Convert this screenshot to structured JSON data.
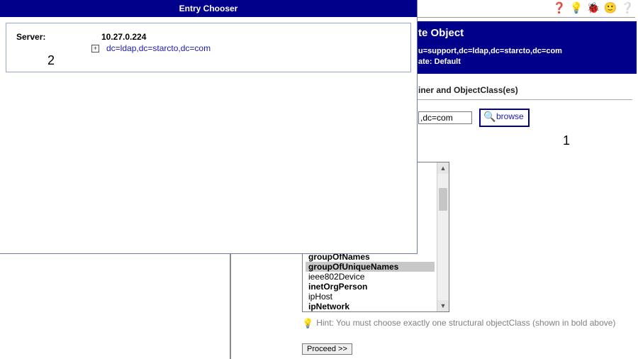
{
  "popup": {
    "title": "Entry Chooser",
    "server_label": "Server:",
    "server_ip": "10.27.0.224",
    "base_dn": "dc=ldap,dc=starcto,dc=com",
    "annotation": "2"
  },
  "toolbar_icons": {
    "help": "help-icon",
    "hint": "lightbulb-icon",
    "bug": "bug-icon",
    "smiley": "smiley-icon",
    "info": "info-icon"
  },
  "create": {
    "title_suffix": "te Object",
    "container_line": "u=support,dc=ldap,dc=starcto,dc=com",
    "template_label": "ate:",
    "template_value": "Default",
    "section_suffix": "iner and ObjectClass(es)",
    "container_value": ",dc=com",
    "browse_label": "browse",
    "browse_annotation": "1"
  },
  "objectclasses": {
    "groupOfNames": "groupOfNames",
    "groupOfUniqueNames": "groupOfUniqueNames",
    "ieee802Device": "ieee802Device",
    "inetOrgPerson": "inetOrgPerson",
    "ipHost": "ipHost",
    "ipNetwork": "ipNetwork"
  },
  "hint": "Hint: You must choose exactly one structural objectClass (shown in bold above)",
  "proceed": "Proceed >>"
}
